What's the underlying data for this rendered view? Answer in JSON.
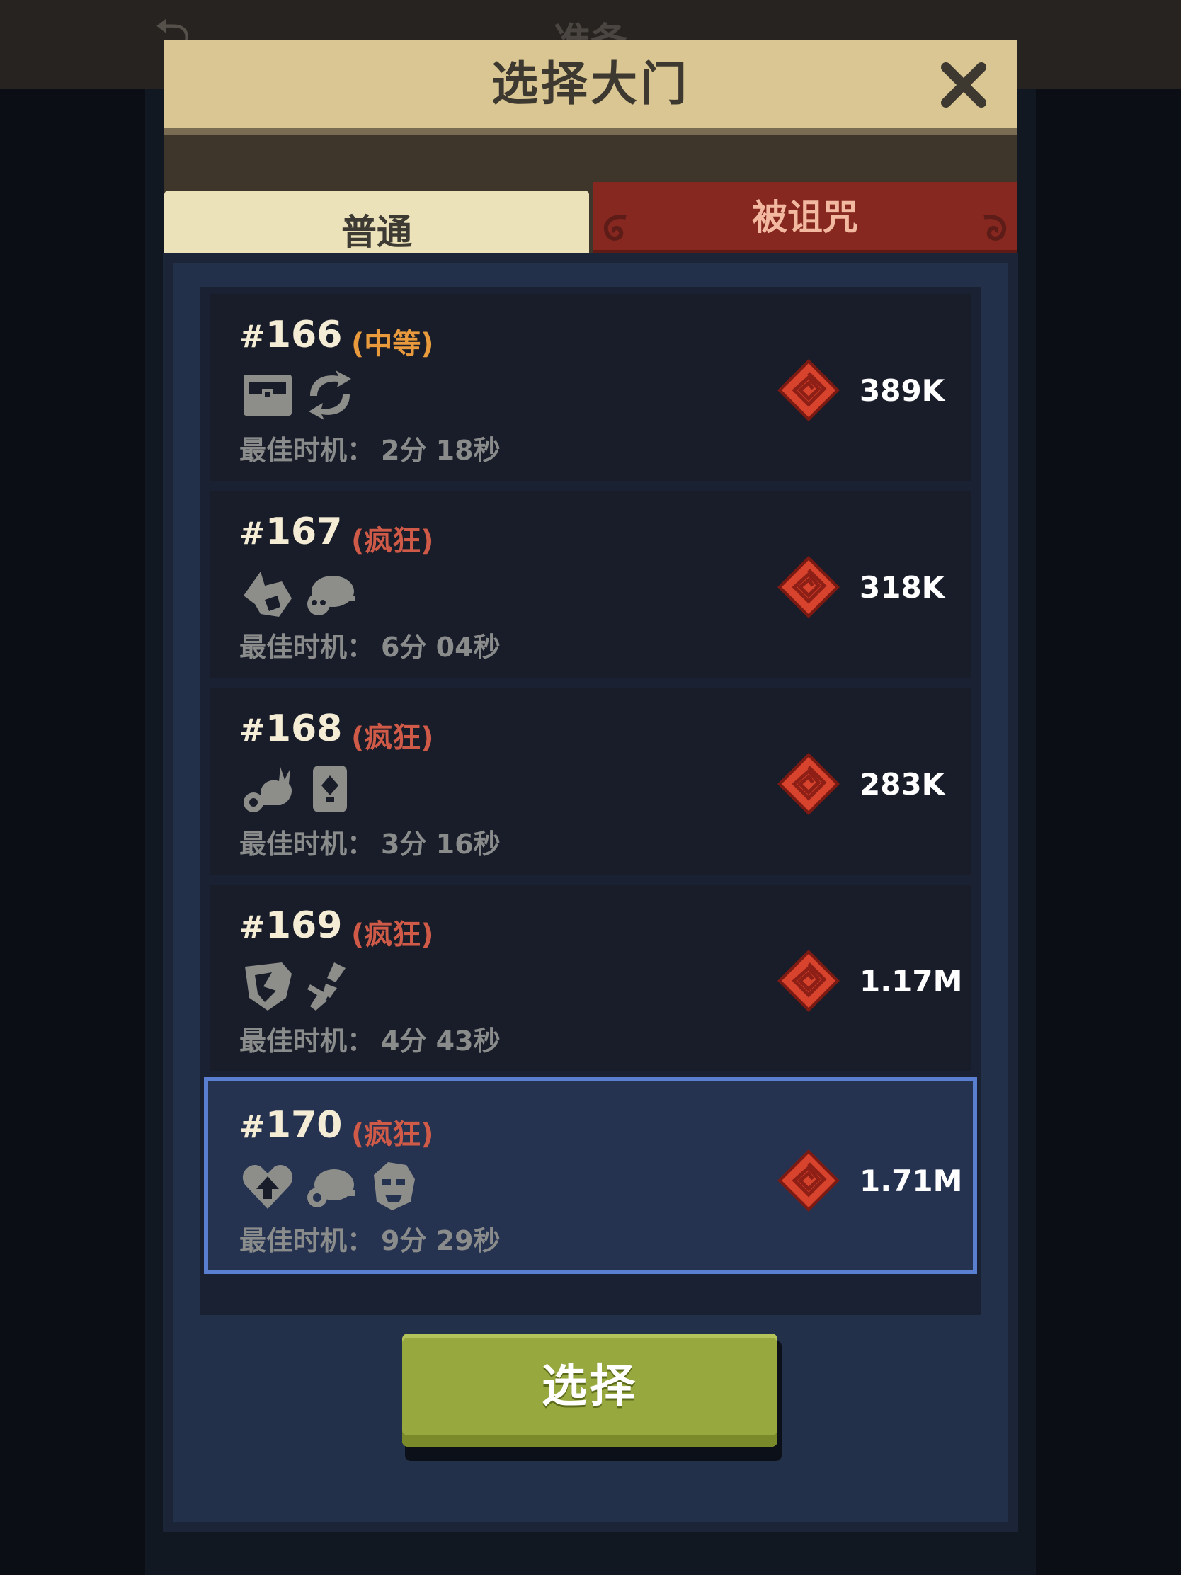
{
  "background": {
    "title": "准备"
  },
  "dialog": {
    "title": "选择大门",
    "tabs": [
      {
        "label": "普通",
        "active": false
      },
      {
        "label": "被诅咒",
        "active": true
      }
    ],
    "best_time_label": "最佳时机：",
    "gates": [
      {
        "hash": "#",
        "number": "166",
        "difficulty": "(中等)",
        "difficulty_level": "medium",
        "modifiers": [
          "treasure-chest-icon",
          "swap-arrows-icon"
        ],
        "best_time": "2分 18秒",
        "reward": "389K",
        "selected": false
      },
      {
        "hash": "#",
        "number": "167",
        "difficulty": "(疯狂)",
        "difficulty_level": "mad",
        "modifiers": [
          "fox-icon",
          "skull-turtle-icon"
        ],
        "best_time": "6分 04秒",
        "reward": "318K",
        "selected": false
      },
      {
        "hash": "#",
        "number": "168",
        "difficulty": "(疯狂)",
        "difficulty_level": "mad",
        "modifiers": [
          "rabbit-icon",
          "card-icon"
        ],
        "best_time": "3分 16秒",
        "reward": "283K",
        "selected": false
      },
      {
        "hash": "#",
        "number": "169",
        "difficulty": "(疯狂)",
        "difficulty_level": "mad",
        "modifiers": [
          "broken-shield-icon",
          "broken-sword-icon"
        ],
        "best_time": "4分 43秒",
        "reward": "1.17M",
        "selected": false
      },
      {
        "hash": "#",
        "number": "170",
        "difficulty": "(疯狂)",
        "difficulty_level": "mad",
        "modifiers": [
          "heart-up-icon",
          "turtle-icon",
          "orc-face-icon"
        ],
        "best_time": "9分 29秒",
        "reward": "1.71M",
        "selected": true
      }
    ],
    "select_button": "选择"
  },
  "colors": {
    "header": "#d9c692",
    "tab_active": "#862820",
    "tab_inactive": "#ebe2b9",
    "selected_border": "#5a7fd0",
    "button": "#97a83e",
    "difficulty_medium": "#e89a3c",
    "difficulty_mad": "#d05a48"
  }
}
